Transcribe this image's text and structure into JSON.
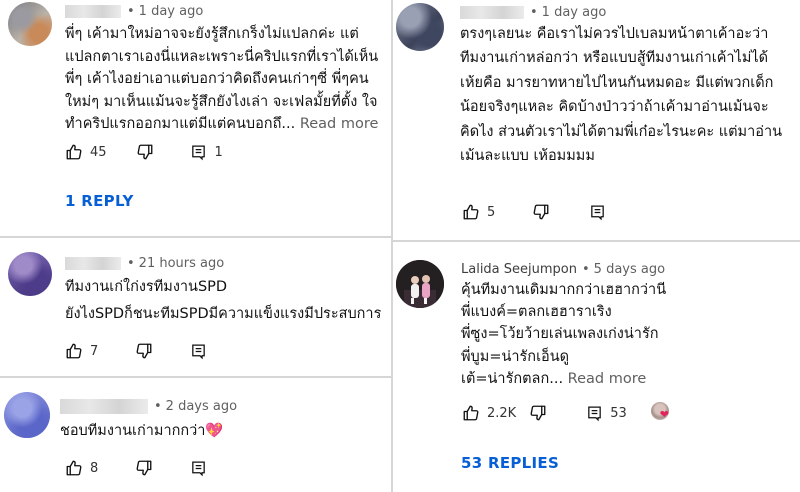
{
  "comments": [
    {
      "time": "1 day ago",
      "lines": [
        "พี่ๆ เค้ามาใหม่อาจจะยังรู้สึกเกร็งไม่แปลกค่ะ แต่",
        "แปลกตาเราเองนี่แหละเพราะนี่คริปแรกที่เราได้เห็น",
        "พี่ๆ เค้าไงอย่าเอาแต่บอกว่าคิดถึงคนเก่าๆซี่ พี่ๆคน",
        "ใหม่ๆ มาเห็นแม้นจะรู้สึกยังไงเล่า จะเฟลมั้ยที่ตั้ง ใจ",
        "ทำคริปแรกออกมาแต่มีแต่คนบอกถึ..."
      ],
      "read_more": "Read more",
      "likes": "45",
      "replies_count": "1",
      "replies_link": "1 REPLY"
    },
    {
      "time": "21 hours ago",
      "lines": [
        "ทีมงานเก่ใก่งรทีมงานSPD",
        "ยังไงSPDก็ชนะทีมSPDมีความแข็งแรงมีประสบการ"
      ],
      "likes": "7"
    },
    {
      "time": "2 days ago",
      "lines": [
        "ชอบทีมงานเก่ามากกว่า💖"
      ],
      "likes": "8"
    },
    {
      "time": "1 day ago",
      "lines": [
        "ตรงๆเลยนะ คือเราไม่ควรไปเบลมหน้าตาเค้าอะว่า",
        "ทีมงานเก่าหล่อกว่า หรือแบบสู้ทีมงานเก่าเค้าไม่ได้",
        "เห้ยคือ มารยาทหายไปไหนกันหมดอะ มีแต่พวกเด็ก",
        "น้อยจริงๆแหละ คิดบ้างป่าวว่าถ้าเค้ามาอ่านเม้นจะ",
        "คิดไง ส่วนตัวเราไม่ได้ตามพี่เก๋อะไรนะคะ แต่มาอ่าน",
        "เม้นละแบบ เห้อมมมม"
      ],
      "likes": "5"
    },
    {
      "author": "Lalida Seejumpon",
      "time": "5 days ago",
      "lines": [
        "คุ้นทีมงานเดิมมากกว่าเฮฮากว่านี",
        "พี่แบงค์=ตลกเฮฮาราเริง",
        "พี่ซูง=โว้ยว้ายเล่นเพลงเก่งน่ารัก",
        "พี่บูม=น่ารักเอ็นดู",
        "เต้=น่ารักตลก..."
      ],
      "read_more": "Read more",
      "likes": "2.2K",
      "replies_count": "53",
      "replies_link": "53 REPLIES"
    }
  ],
  "colors": {
    "link_blue": "#065fd4",
    "meta_gray": "#606060",
    "heart_red": "#e0245e"
  },
  "icons": {
    "like": "thumb-up-icon",
    "dislike": "thumb-down-icon",
    "reply": "comment-icon"
  }
}
